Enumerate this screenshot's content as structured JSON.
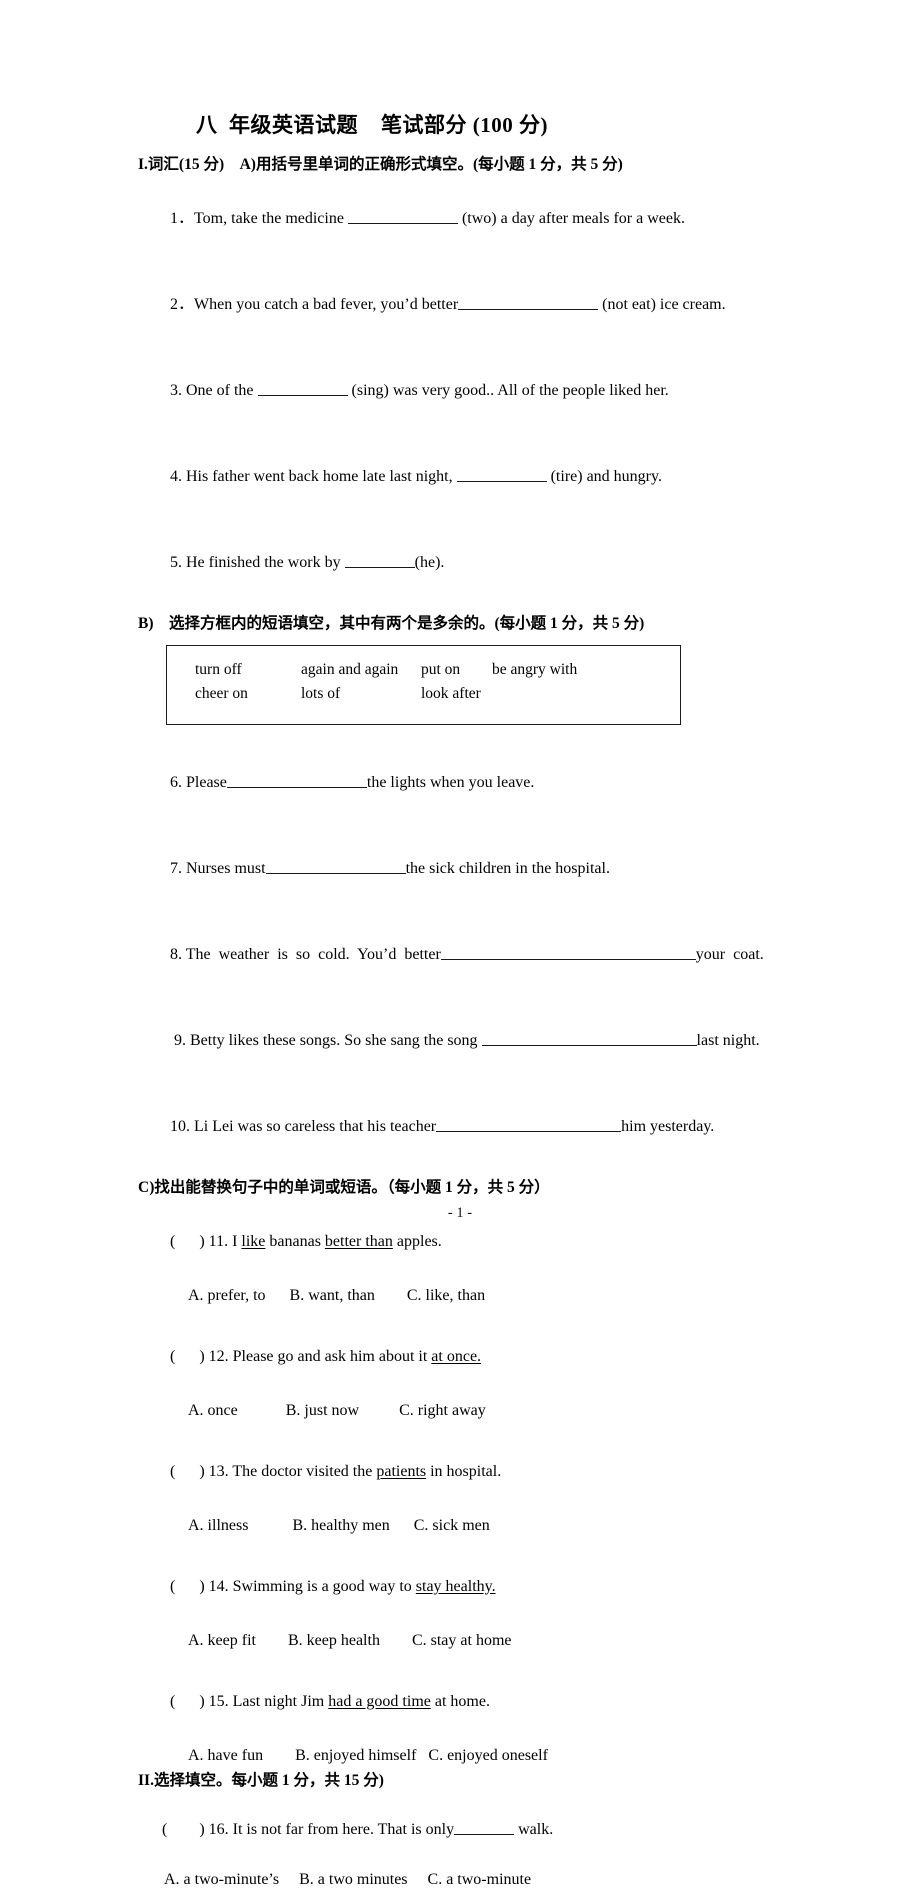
{
  "document": {
    "title": "八  年级英语试题    笔试部分 (100 分)",
    "footer": "- 1 -"
  },
  "section_I": {
    "heading": "I.词汇(15 分)    A)用括号里单词的正确形式填空。(每小题 1 分，共 5 分)",
    "questions": [
      {
        "num": "1．",
        "pre": "Tom, take the medicine ",
        "blank": "b-110",
        "post": " (two) a day after meals for a week."
      },
      {
        "num": "2．",
        "pre": "When you catch a bad fever, you’d better",
        "blank": "b-140",
        "post": " (not eat) ice cream."
      },
      {
        "num": "3. ",
        "pre": "One of the ",
        "blank": "b-90",
        "post": " (sing) was very good.. All of the people liked her."
      },
      {
        "num": "4. ",
        "pre": "His father went back home late last night, ",
        "blank": "b-90",
        "post": " (tire) and hungry."
      },
      {
        "num": "5. ",
        "pre": "He finished the work by ",
        "blank": "b-70",
        "post": "(he)."
      }
    ]
  },
  "section_B": {
    "heading": "B)    选择方框内的短语填空，其中有两个是多余的。(每小题 1 分，共 5 分)",
    "wordbox": {
      "row1": [
        "turn off",
        "again and again",
        "put on",
        "be angry with"
      ],
      "row2": [
        "cheer on",
        "lots of",
        "look after"
      ]
    },
    "questions": [
      {
        "num": "6. ",
        "pre": "Please",
        "blank": "b-140",
        "post": "the lights when you leave."
      },
      {
        "num": "7. ",
        "pre": "Nurses must",
        "blank": "b-140",
        "post": "the sick children in the hospital."
      },
      {
        "num": "8. ",
        "pre": "The  weather  is  so  cold.  You’d  better",
        "blank": "b-255",
        "post": "your  coat."
      },
      {
        "num": " 9. ",
        "pre": "Betty likes these songs. So she sang the song ",
        "blank": "b-215",
        "post": "last night."
      },
      {
        "num": "10. ",
        "pre": "Li Lei was so careless that his teacher",
        "blank": "b-185",
        "post": "him yesterday."
      }
    ]
  },
  "section_C": {
    "heading": "C)找出能替换句子中的单词或短语。（每小题 1 分，共 5 分）",
    "questions": [
      {
        "marker": "(      ) ",
        "num": "11. ",
        "stem_parts": [
          {
            "text": "I ",
            "underline": false
          },
          {
            "text": "like",
            "underline": true
          },
          {
            "text": " bananas ",
            "underline": false
          },
          {
            "text": "better than",
            "underline": true
          },
          {
            "text": " apples.",
            "underline": false
          }
        ],
        "options": "A. prefer, to      B. want, than        C. like, than"
      },
      {
        "marker": "(      ) ",
        "num": "12. ",
        "stem_parts": [
          {
            "text": "Please go and ask him about it ",
            "underline": false
          },
          {
            "text": "at once.",
            "underline": true
          }
        ],
        "options": "A. once            B. just now          C. right away"
      },
      {
        "marker": "(      ) ",
        "num": "13. ",
        "stem_parts": [
          {
            "text": "The doctor visited the ",
            "underline": false
          },
          {
            "text": "patients",
            "underline": true
          },
          {
            "text": " in hospital.",
            "underline": false
          }
        ],
        "options": "A. illness           B. healthy men      C. sick men"
      },
      {
        "marker": "(      ) ",
        "num": "14. ",
        "stem_parts": [
          {
            "text": "Swimming is a good way to ",
            "underline": false
          },
          {
            "text": "stay healthy.",
            "underline": true
          }
        ],
        "options": "A. keep fit        B. keep health        C. stay at home"
      },
      {
        "marker": "(      ) ",
        "num": "15. ",
        "stem_parts": [
          {
            "text": "Last night Jim ",
            "underline": false
          },
          {
            "text": "had a good time",
            "underline": true
          },
          {
            "text": " at home.",
            "underline": false
          }
        ],
        "options": "A. have fun        B. enjoyed himself   C. enjoyed oneself"
      }
    ]
  },
  "section_II": {
    "heading": "II.选择填空。每小题 1 分，共 15 分)",
    "question16": {
      "marker": "(        ) ",
      "num": "16. ",
      "pre": "It is not far from here. That is only",
      "blank": "b-60",
      "post": " walk.",
      "options": "A. a two-minute’s     B. a two minutes     C. a two-minute"
    }
  }
}
